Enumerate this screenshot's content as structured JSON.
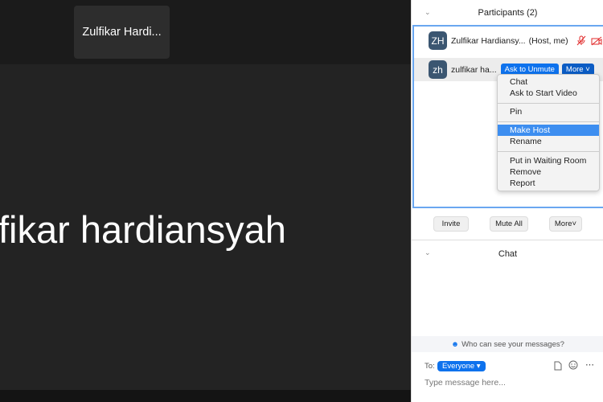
{
  "video": {
    "tile_name": "Zulfikar Hardi...",
    "speaker_name": "fikar hardiansyah"
  },
  "participants": {
    "title": "Participants (2)",
    "rows": [
      {
        "initials": "ZH",
        "name": "Zulfikar Hardiansy...",
        "role": "(Host, me)"
      },
      {
        "initials": "zh",
        "name": "zulfikar ha...",
        "ask_label": "Ask to Unmute",
        "more_label": "More"
      }
    ],
    "menu": [
      "Chat",
      "Ask to Start Video",
      "Pin",
      "Make Host",
      "Rename",
      "Put in Waiting Room",
      "Remove",
      "Report"
    ],
    "menu_highlighted": "Make Host",
    "invite": "Invite",
    "mute_all": "Mute All",
    "more": "More"
  },
  "chat": {
    "title": "Chat",
    "who_can_see": "Who can see your messages?",
    "to_label": "To:",
    "recipient": "Everyone",
    "placeholder": "Type message here..."
  },
  "colors": {
    "accent": "#0e72ed",
    "muted_red": "#e02828"
  }
}
